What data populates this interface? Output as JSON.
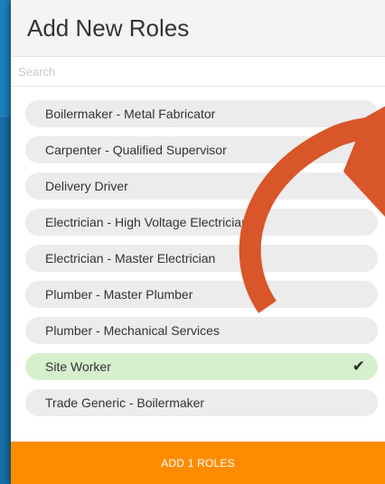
{
  "modal": {
    "title": "Add New Roles",
    "search_placeholder": "Search",
    "roles": [
      {
        "label": "Boilermaker - Metal Fabricator",
        "selected": false
      },
      {
        "label": "Carpenter - Qualified Supervisor",
        "selected": false
      },
      {
        "label": "Delivery Driver",
        "selected": false
      },
      {
        "label": "Electrician - High Voltage Electrician",
        "selected": false
      },
      {
        "label": "Electrician - Master Electrician",
        "selected": false
      },
      {
        "label": "Plumber - Master Plumber",
        "selected": false
      },
      {
        "label": "Plumber - Mechanical Services",
        "selected": false
      },
      {
        "label": "Site Worker",
        "selected": true
      },
      {
        "label": "Trade Generic - Boilermaker",
        "selected": false
      }
    ],
    "check_glyph": "✔",
    "add_button_label": "ADD 1 ROLES"
  },
  "colors": {
    "accent_orange": "#ff8c00",
    "selected_green": "#d6efcd",
    "annotation_arrow": "#d9552a"
  },
  "icons": {
    "check": "check-icon",
    "annotation": "curved-arrow-icon"
  }
}
